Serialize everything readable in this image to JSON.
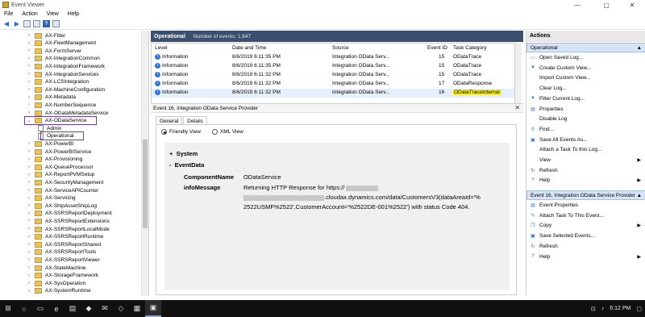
{
  "window": {
    "title": "Event Viewer",
    "minimize": "—",
    "maximize": "▢",
    "close": "✕"
  },
  "menu": [
    "File",
    "Action",
    "View",
    "Help"
  ],
  "tree": {
    "items": [
      {
        "label": "AX-Filter",
        "type": "folder"
      },
      {
        "label": "AX-FleetManagement",
        "type": "folder"
      },
      {
        "label": "AX-FormServer",
        "type": "folder"
      },
      {
        "label": "AX-IntegrationCommon",
        "type": "folder"
      },
      {
        "label": "AX-IntegrationFramework",
        "type": "folder"
      },
      {
        "label": "AX-IntegrationServices",
        "type": "folder"
      },
      {
        "label": "AX-LCSIntegration",
        "type": "folder"
      },
      {
        "label": "AX-MachineConfiguration",
        "type": "folder"
      },
      {
        "label": "AX-Metadata",
        "type": "folder"
      },
      {
        "label": "AX-NumberSequence",
        "type": "folder"
      },
      {
        "label": "AX-ODataMetadataService",
        "type": "folder"
      },
      {
        "label": "AX-ODataService",
        "type": "folder-open"
      },
      {
        "label": "Admin",
        "type": "log"
      },
      {
        "label": "Operational",
        "type": "log"
      },
      {
        "label": "AX-PowerBI",
        "type": "folder"
      },
      {
        "label": "AX-PowerBIService",
        "type": "folder"
      },
      {
        "label": "AX-Provisioning",
        "type": "folder"
      },
      {
        "label": "AX-QueueProcessor",
        "type": "folder"
      },
      {
        "label": "AX-ReportPVMSetup",
        "type": "folder"
      },
      {
        "label": "AX-SecurityManagement",
        "type": "folder"
      },
      {
        "label": "AX-ServiceAPICounter",
        "type": "folder"
      },
      {
        "label": "AX-Servicing",
        "type": "folder"
      },
      {
        "label": "AX-ShipAssetShipLog",
        "type": "folder"
      },
      {
        "label": "AX-SSRSReportDeployment",
        "type": "folder"
      },
      {
        "label": "AX-SSRSReportExtensions",
        "type": "folder"
      },
      {
        "label": "AX-SSRSReportLocalMode",
        "type": "folder"
      },
      {
        "label": "AX-SSRSReportRuntime",
        "type": "folder"
      },
      {
        "label": "AX-SSRSReportShared",
        "type": "folder"
      },
      {
        "label": "AX-SSRSReportTools",
        "type": "folder"
      },
      {
        "label": "AX-SSRSReportViewer",
        "type": "folder"
      },
      {
        "label": "AX-StateMachine",
        "type": "folder"
      },
      {
        "label": "AX-StorageFramework",
        "type": "folder"
      },
      {
        "label": "AX-SysOperation",
        "type": "folder"
      },
      {
        "label": "AX-SystemRuntime",
        "type": "folder"
      }
    ]
  },
  "main": {
    "header_title": "Operational",
    "header_count": "Number of events: 1,647",
    "columns": [
      "Level",
      "Date and Time",
      "Source",
      "Event ID",
      "Task Category"
    ],
    "rows": [
      {
        "level": "Information",
        "date": "8/6/2019 6:11:35 PM",
        "source": "Integration OData Serv...",
        "event_id": "15",
        "category": "ODataTrace"
      },
      {
        "level": "Information",
        "date": "8/6/2019 6:11:35 PM",
        "source": "Integration OData Serv...",
        "event_id": "15",
        "category": "ODataTrace"
      },
      {
        "level": "Information",
        "date": "8/6/2019 6:11:32 PM",
        "source": "Integration OData Serv...",
        "event_id": "15",
        "category": "ODataTrace"
      },
      {
        "level": "Information",
        "date": "8/6/2019 6:11:32 PM",
        "source": "Integration OData Serv...",
        "event_id": "17",
        "category": "ODataResponse"
      },
      {
        "level": "Information",
        "date": "8/6/2019 6:11:32 PM",
        "source": "Integration OData Serv...",
        "event_id": "16",
        "category": "ODataTraceInternal"
      }
    ],
    "detail_title": "Event 16, Integration OData Service Provider",
    "tabs": [
      "General",
      "Details"
    ],
    "view_options": {
      "friendly": "Friendly View",
      "xml": "XML View"
    },
    "event_data": {
      "system": "System",
      "eventdata": "EventData",
      "component_name_key": "ComponentName",
      "component_name_val": "ODataService",
      "info_key": "infoMessage",
      "info_line1": "Returning HTTP Response for https://",
      "info_line2": ".cloudax.dynamics.com/data/CustomersV3(dataAreaId='%",
      "info_line3": "2522USMF%2522',CustomerAccount='%2522DE-001%2522') with status Code 404."
    }
  },
  "actions": {
    "title": "Actions",
    "section1": "Operational",
    "items1": [
      {
        "label": "Open Saved Log...",
        "icon": "folder-icon"
      },
      {
        "label": "Create Custom View...",
        "icon": "filter-icon"
      },
      {
        "label": "Import Custom View...",
        "icon": "blank"
      },
      {
        "label": "Clear Log...",
        "icon": "blank"
      },
      {
        "label": "Filter Current Log...",
        "icon": "filter-icon"
      },
      {
        "label": "Properties",
        "icon": "properties-icon"
      },
      {
        "label": "Disable Log",
        "icon": "blank"
      },
      {
        "label": "Find...",
        "icon": "find-icon"
      },
      {
        "label": "Save All Events As...",
        "icon": "save-icon"
      },
      {
        "label": "Attach a Task To this Log...",
        "icon": "blank"
      },
      {
        "label": "View",
        "icon": "blank",
        "submenu": true
      },
      {
        "label": "Refresh",
        "icon": "refresh-icon"
      },
      {
        "label": "Help",
        "icon": "help-icon",
        "submenu": true
      }
    ],
    "section2": "Event 16, Integration OData Service Provider",
    "items2": [
      {
        "label": "Event Properties",
        "icon": "properties-icon"
      },
      {
        "label": "Attach Task To This Event...",
        "icon": "task-icon"
      },
      {
        "label": "Copy",
        "icon": "copy-icon",
        "submenu": true
      },
      {
        "label": "Save Selected Events...",
        "icon": "save-icon"
      },
      {
        "label": "Refresh",
        "icon": "refresh-icon"
      },
      {
        "label": "Help",
        "icon": "help-icon",
        "submenu": true
      }
    ]
  },
  "taskbar": {
    "time": "6:12 PM"
  }
}
